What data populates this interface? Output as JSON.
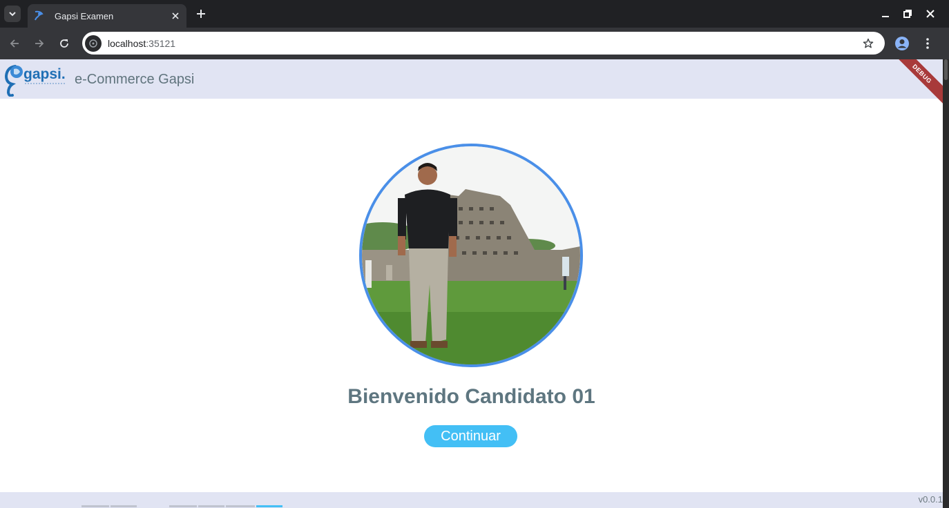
{
  "browser": {
    "tab_title": "Gapsi Examen",
    "url_host": "localhost",
    "url_port": ":35121"
  },
  "app": {
    "title": "e-Commerce Gapsi",
    "logo_text": "gapsi.",
    "debug_banner": "DEBUG",
    "welcome_text": "Bienvenido Candidato 01",
    "continue_label": "Continuar",
    "version": "v0.0.1"
  },
  "colors": {
    "appbar": "#e1e4f3",
    "accent_button": "#43bff5",
    "avatar_ring": "#4a8fe8",
    "title_text": "#60747d",
    "debug_banner": "#a83a3a"
  },
  "icons": [
    "tab-search-icon",
    "favicon-icon",
    "close-icon",
    "plus-icon",
    "minimize-icon",
    "restore-icon",
    "window-close-icon",
    "back-icon",
    "forward-icon",
    "reload-icon",
    "site-info-icon",
    "star-icon",
    "profile-icon",
    "more-icon"
  ]
}
